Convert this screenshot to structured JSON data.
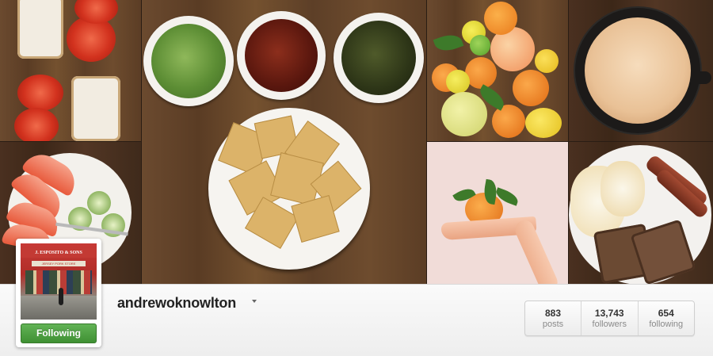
{
  "profile": {
    "username": "andrewoknowlton",
    "follow_button_label": "Following",
    "avatar_sign_text": "J. ESPOSITO & SONS",
    "avatar_sub_text": "JERSEY PORK STORE"
  },
  "stats": [
    {
      "value": "883",
      "label": "posts"
    },
    {
      "value": "13,743",
      "label": "followers"
    },
    {
      "value": "654",
      "label": "following"
    }
  ],
  "colors": {
    "follow_green": "#4fa243",
    "username": "#222222",
    "stat_label": "#8a8a8a"
  },
  "icons": {
    "username_dropdown": "caret-down-icon"
  }
}
